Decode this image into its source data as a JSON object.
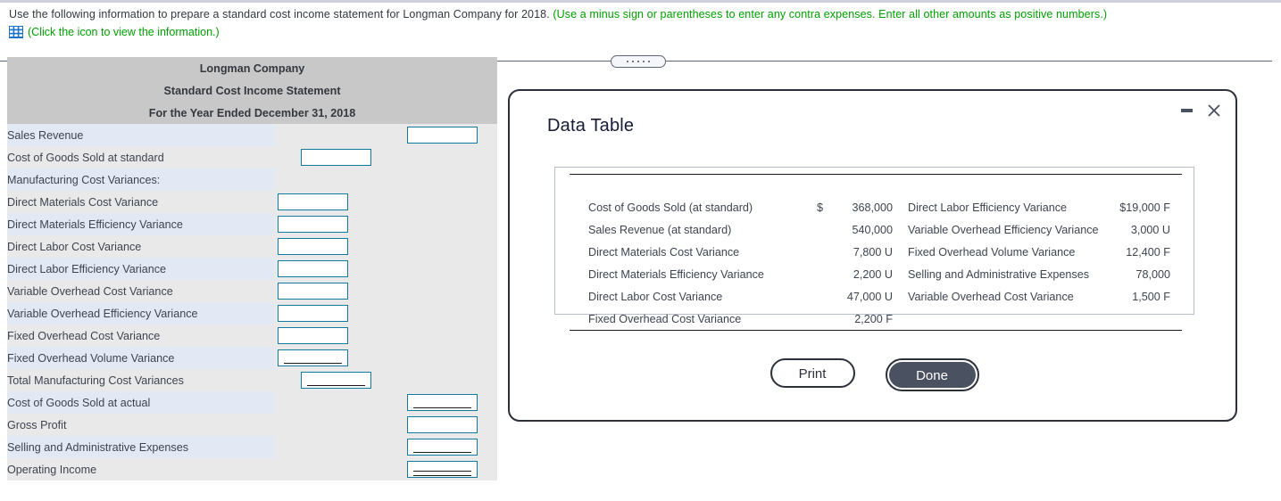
{
  "instructions": {
    "main_black": "Use the following information to prepare a standard cost income statement for Longman Company for 2018.",
    "main_green": "(Use a minus sign or parentheses to enter any contra expenses. Enter all other amounts as positive numbers.)",
    "icon_link": "(Click the icon to view the information.)",
    "icon_name": "spreadsheet-grid-icon",
    "green_color": "#00a000"
  },
  "statement": {
    "title_line1": "Longman Company",
    "title_line2": "Standard Cost Income Statement",
    "title_line3": "For the Year Ended December 31, 2018",
    "rows": [
      {
        "label": "Sales Revenue",
        "indent": 0,
        "input_col": "right",
        "underline": "none"
      },
      {
        "label": "Cost of Goods Sold at standard",
        "indent": 0,
        "input_col": "mid",
        "underline": "none"
      },
      {
        "label": "Manufacturing Cost Variances:",
        "indent": 0,
        "input_col": "none",
        "underline": "none"
      },
      {
        "label": "Direct Materials Cost Variance",
        "indent": 1,
        "input_col": "left",
        "underline": "none"
      },
      {
        "label": "Direct Materials Efficiency Variance",
        "indent": 1,
        "input_col": "left",
        "underline": "none"
      },
      {
        "label": "Direct Labor Cost Variance",
        "indent": 1,
        "input_col": "left",
        "underline": "none"
      },
      {
        "label": "Direct Labor Efficiency Variance",
        "indent": 1,
        "input_col": "left",
        "underline": "none"
      },
      {
        "label": "Variable Overhead Cost Variance",
        "indent": 1,
        "input_col": "left",
        "underline": "none"
      },
      {
        "label": "Variable Overhead Efficiency Variance",
        "indent": 1,
        "input_col": "left",
        "underline": "none"
      },
      {
        "label": "Fixed Overhead Cost Variance",
        "indent": 1,
        "input_col": "left",
        "underline": "none"
      },
      {
        "label": "Fixed Overhead Volume Variance",
        "indent": 1,
        "input_col": "left",
        "underline": "single"
      },
      {
        "label": "Total Manufacturing Cost Variances",
        "indent": 2,
        "input_col": "mid",
        "underline": "single"
      },
      {
        "label": "Cost of Goods Sold at actual",
        "indent": 0,
        "input_col": "right",
        "underline": "single"
      },
      {
        "label": "Gross Profit",
        "indent": 0,
        "input_col": "right",
        "underline": "none"
      },
      {
        "label": "Selling and Administrative Expenses",
        "indent": 0,
        "input_col": "right",
        "underline": "single"
      },
      {
        "label": "Operating Income",
        "indent": 0,
        "input_col": "right",
        "underline": "double"
      }
    ],
    "input_value": "",
    "input_border_color": "#127a9e"
  },
  "dialog": {
    "title": "Data Table",
    "minimize_icon": "minimize-icon",
    "close_icon": "close-icon",
    "print_label": "Print",
    "done_label": "Done",
    "table": {
      "rows": [
        {
          "name1": "Cost of Goods Sold (at standard)",
          "currency": "$",
          "amount1": "368,000",
          "name2": "Direct Labor Efficiency Variance",
          "amount2": "$19,000 F"
        },
        {
          "name1": "Sales Revenue (at standard)",
          "currency": "",
          "amount1": "540,000",
          "name2": "Variable Overhead Efficiency Variance",
          "amount2": "3,000 U"
        },
        {
          "name1": "Direct Materials Cost Variance",
          "currency": "",
          "amount1": "7,800 U",
          "name2": "Fixed Overhead Volume Variance",
          "amount2": "12,400 F"
        },
        {
          "name1": "Direct Materials Efficiency Variance",
          "currency": "",
          "amount1": "2,200 U",
          "name2": "Selling and Administrative Expenses",
          "amount2": "78,000"
        },
        {
          "name1": "Direct Labor Cost Variance",
          "currency": "",
          "amount1": "47,000 U",
          "name2": "Variable Overhead Cost Variance",
          "amount2": "1,500 F"
        },
        {
          "name1": "Fixed Overhead Cost Variance",
          "currency": "",
          "amount1": "2,200 F",
          "name2": "",
          "amount2": ""
        }
      ]
    }
  },
  "splitter": {
    "name": "horizontal-splitter-handle"
  }
}
